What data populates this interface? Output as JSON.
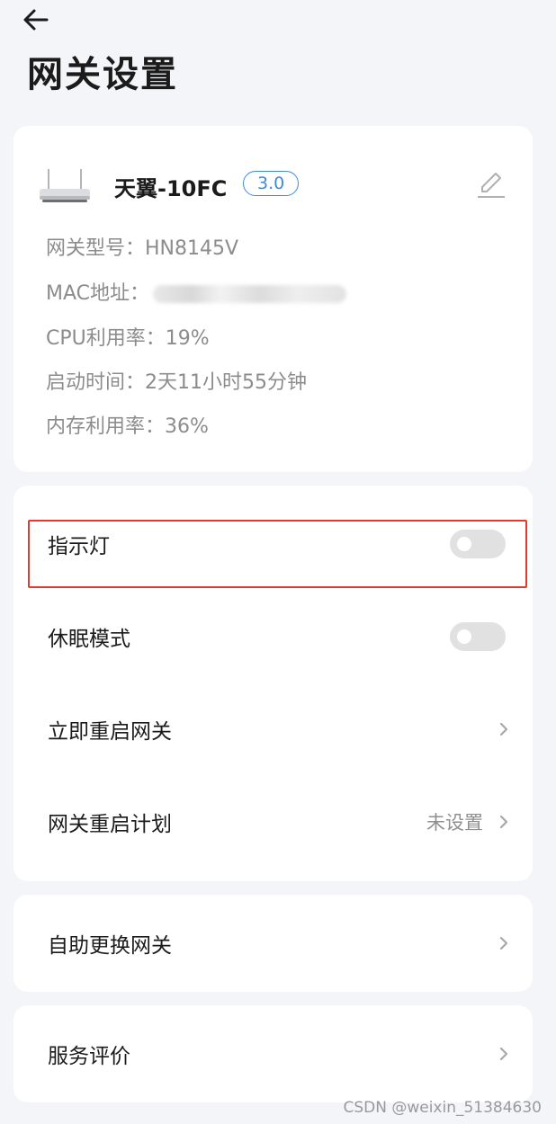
{
  "header": {
    "back_icon": "arrow-left-icon",
    "title": "网关设置"
  },
  "device": {
    "name": "天翼-10FC",
    "version": "3.0",
    "icon": "router-icon",
    "edit_icon": "pencil-icon",
    "info": [
      {
        "label": "网关型号：",
        "value": "HN8145V"
      },
      {
        "label": "MAC地址：",
        "value": ""
      },
      {
        "label": "CPU利用率：",
        "value": "19%"
      },
      {
        "label": "启动时间：",
        "value": "2天11小时55分钟"
      },
      {
        "label": "内存利用率：",
        "value": "36%"
      }
    ]
  },
  "settings": {
    "indicator_light": {
      "label": "指示灯",
      "enabled": false
    },
    "sleep_mode": {
      "label": "休眠模式",
      "enabled": false
    },
    "reboot_now": {
      "label": "立即重启网关"
    },
    "reboot_plan": {
      "label": "网关重启计划",
      "value": "未设置"
    }
  },
  "extra": {
    "swap_gateway": {
      "label": "自助更换网关"
    },
    "service_review": {
      "label": "服务评价"
    }
  },
  "watermark": "CSDN @weixin_51384630",
  "colors": {
    "background": "#f4f5f9",
    "accent": "#3b8be0",
    "highlight": "#e23a2e",
    "toggle_off": "#e1e1e1"
  }
}
